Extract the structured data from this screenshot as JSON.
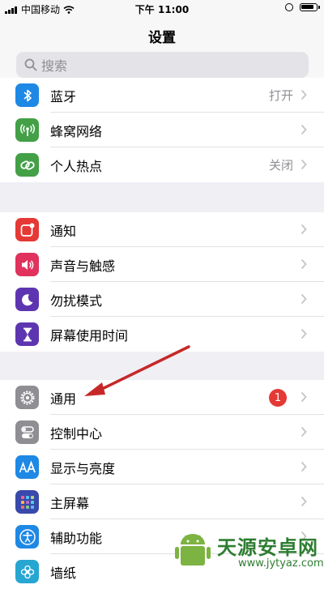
{
  "status_bar": {
    "carrier": "中国移动",
    "time": "下午 11:00"
  },
  "header": {
    "title": "设置",
    "search_placeholder": "搜索"
  },
  "groups": [
    {
      "items": [
        {
          "label": "蓝牙",
          "value": "打开",
          "icon": "bluetooth-icon",
          "color": "#1e88e5"
        },
        {
          "label": "蜂窝网络",
          "value": "",
          "icon": "cellular-antenna-icon",
          "color": "#43a047"
        },
        {
          "label": "个人热点",
          "value": "关闭",
          "icon": "hotspot-chain-icon",
          "color": "#43a047"
        }
      ]
    },
    {
      "items": [
        {
          "label": "通知",
          "icon": "notification-icon",
          "color": "#e53935"
        },
        {
          "label": "声音与触感",
          "icon": "speaker-icon",
          "color": "#e0325c"
        },
        {
          "label": "勿扰模式",
          "icon": "moon-icon",
          "color": "#5e35b1"
        },
        {
          "label": "屏幕使用时间",
          "icon": "hourglass-icon",
          "color": "#5e35b1"
        }
      ]
    },
    {
      "items": [
        {
          "label": "通用",
          "badge": "1",
          "icon": "gear-icon",
          "color": "#8e8e93"
        },
        {
          "label": "控制中心",
          "icon": "toggles-icon",
          "color": "#8e8e93"
        },
        {
          "label": "显示与亮度",
          "icon": "text-size-icon",
          "color": "#1e88e5"
        },
        {
          "label": "主屏幕",
          "icon": "home-grid-icon",
          "color": "#3949ab"
        },
        {
          "label": "辅助功能",
          "icon": "accessibility-icon",
          "color": "#1e88e5"
        },
        {
          "label": "墙纸",
          "icon": "flower-icon",
          "color": "#26a6d1"
        }
      ]
    }
  ],
  "watermark": {
    "title": "天源安卓网",
    "url": "www.jytyaz.com"
  },
  "annotation_arrow": {
    "color": "#c62828"
  }
}
